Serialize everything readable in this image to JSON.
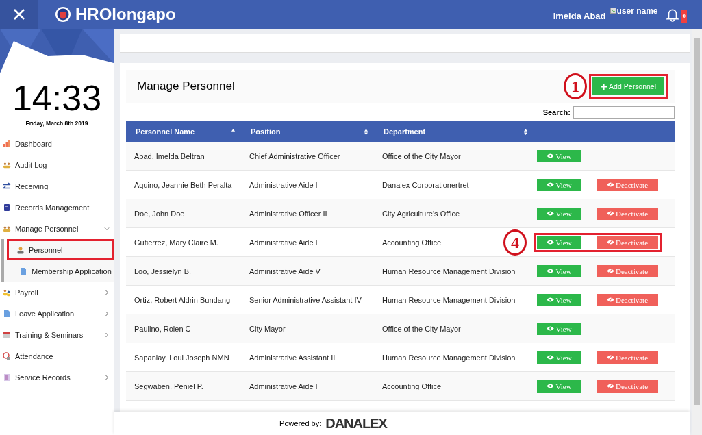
{
  "header": {
    "logo_text": "HROlongapo",
    "user_name": "Imelda Abad",
    "avatar_alt": "user name",
    "notification_count": "0"
  },
  "clock": {
    "time": "14:33",
    "date": "Friday, March 8th 2019"
  },
  "sidebar": {
    "items": [
      {
        "label": "Dashboard",
        "kind": "chart"
      },
      {
        "label": "Audit Log",
        "kind": "people"
      },
      {
        "label": "Receiving",
        "kind": "arrows"
      },
      {
        "label": "Records Management",
        "kind": "book"
      },
      {
        "label": "Manage Personnel",
        "kind": "people",
        "expanded": true,
        "children": [
          {
            "label": "Personnel",
            "kind": "person",
            "highlighted": true
          },
          {
            "label": "Membership Application",
            "kind": "doc",
            "highlighted": false
          }
        ]
      },
      {
        "label": "Payroll",
        "kind": "people2",
        "expanded": false
      },
      {
        "label": "Leave Application",
        "kind": "doc",
        "expanded": false
      },
      {
        "label": "Training & Seminars",
        "kind": "calendar",
        "expanded": false
      },
      {
        "label": "Attendance",
        "kind": "clock"
      },
      {
        "label": "Service Records",
        "kind": "list",
        "expanded": false
      }
    ]
  },
  "panel": {
    "title": "Manage Personnel",
    "add_button": {
      "label": "Add Personnel",
      "highlighted": true,
      "callout": "1"
    },
    "search_label": "Search:"
  },
  "table": {
    "columns": [
      {
        "label": "Personnel Name",
        "sorted": true
      },
      {
        "label": "Position",
        "sorted": false
      },
      {
        "label": "Department",
        "sorted": false
      }
    ],
    "rows": [
      {
        "name": "Abad, Imelda Beltran",
        "position": "Chief Administrative Officer",
        "department": "Office of the City Mayor",
        "view": "View",
        "highlighted": false
      },
      {
        "name": "Aquino, Jeannie Beth Peralta",
        "position": "Administrative Aide I",
        "department": "Danalex Corporationertret",
        "view": "View",
        "deactivate": "Deactivate",
        "highlighted": false
      },
      {
        "name": "Doe, John Doe",
        "position": "Administrative Officer II",
        "department": "City Agriculture's Office",
        "view": "View",
        "deactivate": "Deactivate",
        "highlighted": false
      },
      {
        "name": "Gutierrez, Mary Claire M.",
        "position": "Administrative Aide I",
        "department": "Accounting Office",
        "view": "View",
        "deactivate": "Deactivate",
        "highlighted": true,
        "callout": "4"
      },
      {
        "name": "Loo, Jessielyn B.",
        "position": "Administrative Aide V",
        "department": "Human Resource Management Division",
        "view": "View",
        "deactivate": "Deactivate",
        "highlighted": false
      },
      {
        "name": "Ortiz, Robert Aldrin Bundang",
        "position": "Senior Administrative Assistant IV",
        "department": "Human Resource Management Division",
        "view": "View",
        "deactivate": "Deactivate",
        "highlighted": false
      },
      {
        "name": "Paulino, Rolen C",
        "position": "City Mayor",
        "department": "Office of the City Mayor",
        "view": "View",
        "highlighted": false
      },
      {
        "name": "Sapanlay, Loui Joseph NMN",
        "position": "Administrative Assistant II",
        "department": "Human Resource Management Division",
        "view": "View",
        "deactivate": "Deactivate",
        "highlighted": false
      },
      {
        "name": "Segwaben, Peniel P.",
        "position": "Administrative Aide I",
        "department": "Accounting Office",
        "view": "View",
        "deactivate": "Deactivate",
        "highlighted": false
      }
    ]
  },
  "footer": {
    "label": "Powered by:",
    "brand": "DANALEX"
  }
}
